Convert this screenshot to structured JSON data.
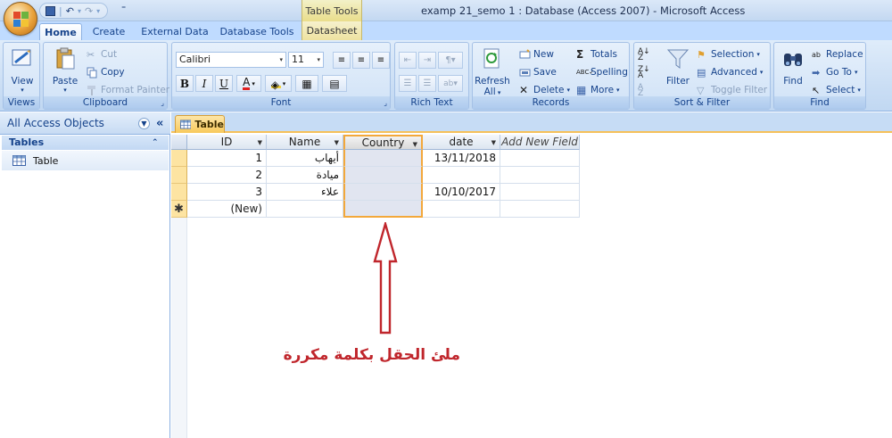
{
  "window": {
    "title": "examp 21_semo 1 : Database (Access 2007)  -  Microsoft Access",
    "context_tab_title": "Table Tools"
  },
  "quick_access": {
    "undo": "↶",
    "redo": "↷",
    "more": "⁼"
  },
  "ribbon_tabs": [
    {
      "label": "Home",
      "active": true
    },
    {
      "label": "Create"
    },
    {
      "label": "External Data"
    },
    {
      "label": "Database Tools"
    },
    {
      "label": "Datasheet",
      "context": true
    }
  ],
  "ribbon": {
    "views": {
      "view_label": "View",
      "group_label": "Views"
    },
    "clipboard": {
      "paste_label": "Paste",
      "cut_label": "Cut",
      "copy_label": "Copy",
      "format_painter_label": "Format Painter",
      "group_label": "Clipboard"
    },
    "font": {
      "font_name": "Calibri",
      "font_size": "11",
      "bold": "B",
      "italic": "I",
      "underline": "U",
      "font_color": "A",
      "group_label": "Font"
    },
    "rich_text": {
      "group_label": "Rich Text"
    },
    "records": {
      "refresh_label": "Refresh",
      "refresh_sub": "All",
      "new_label": "New",
      "save_label": "Save",
      "delete_label": "Delete",
      "totals_label": "Totals",
      "spelling_label": "Spelling",
      "more_label": "More",
      "group_label": "Records"
    },
    "sort_filter": {
      "filter_label": "Filter",
      "selection_label": "Selection",
      "advanced_label": "Advanced",
      "toggle_filter_label": "Toggle Filter",
      "group_label": "Sort & Filter"
    },
    "find": {
      "find_label": "Find",
      "replace_label": "Replace",
      "goto_label": "Go To",
      "select_label": "Select",
      "group_label": "Find"
    }
  },
  "nav_pane": {
    "header": "All Access Objects",
    "group": "Tables",
    "items": [
      {
        "label": "Table"
      }
    ]
  },
  "document": {
    "tab_label": "Table",
    "columns": [
      "ID",
      "Name",
      "Country",
      "date",
      "Add New Field"
    ],
    "rows": [
      {
        "id": "1",
        "name": "أيهاب",
        "country": "",
        "date": "13/11/2018"
      },
      {
        "id": "2",
        "name": "ميادة",
        "country": "",
        "date": ""
      },
      {
        "id": "3",
        "name": "علاء",
        "country": "",
        "date": "10/10/2017"
      }
    ],
    "new_row_marker": "✱",
    "new_row_label": "(New)"
  },
  "annotation": {
    "text": "ملئ الحقل بكلمة مكررة",
    "color": "#c0262c"
  }
}
